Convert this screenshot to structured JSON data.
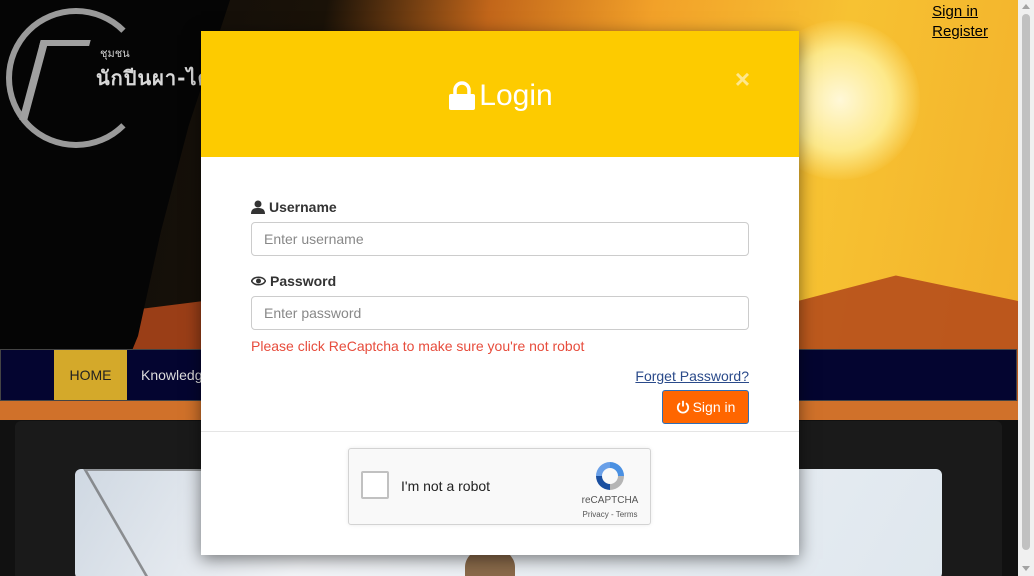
{
  "site": {
    "logo_subtext": "ชุมชน",
    "logo_text": "นักปีนผา-ไต่เข"
  },
  "top_links": {
    "sign_in": "Sign in",
    "register": "Register"
  },
  "nav": {
    "home": "HOME",
    "item_2": "Knowledg"
  },
  "modal": {
    "title": "Login",
    "close": "×",
    "username_label": "Username",
    "username_placeholder": "Enter username",
    "password_label": "Password",
    "password_placeholder": "Enter password",
    "error_text": "Please click ReCaptcha to make sure you're not robot",
    "forget_password": "Forget Password?",
    "sign_in_button": "Sign in"
  },
  "recaptcha": {
    "label": "I'm not a robot",
    "brand": "reCAPTCHA",
    "terms": "Privacy - Terms"
  },
  "colors": {
    "modal_header": "#fdcb00",
    "sign_in_button": "#ff6600",
    "error_text": "#e74c3c",
    "nav_bg": "#040530",
    "nav_home": "#d4a92a"
  }
}
